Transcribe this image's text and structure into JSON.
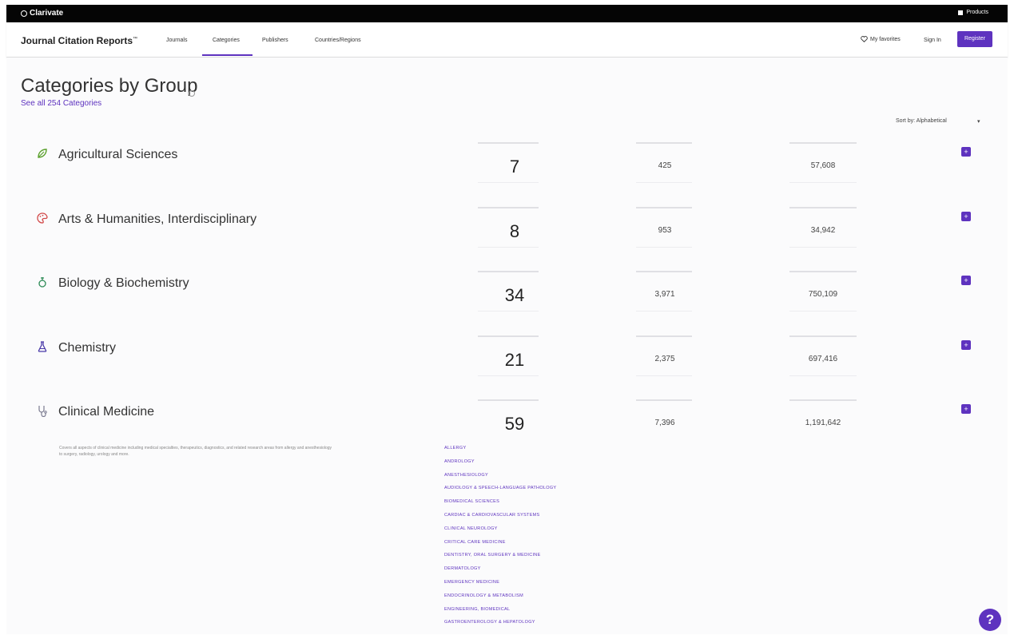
{
  "topbar": {
    "brand": "Clarivate",
    "products_label": "Products"
  },
  "nav": {
    "product_title": "Journal Citation Reports",
    "product_mark": "™",
    "links": [
      "Journals",
      "Categories",
      "Publishers",
      "Countries/Regions"
    ],
    "active_link": "Categories",
    "my_favorites": "My favorites",
    "sign_in": "Sign In",
    "register": "Register"
  },
  "header": {
    "title": "Categories by Group",
    "see_all": "See all 254 Categories",
    "sort_label": "Sort by: Alphabetical",
    "sort_caret": "▾"
  },
  "groups": [
    {
      "name": "Agricultural Sciences",
      "icon": "leaf-icon",
      "icon_color": "#5aa02c",
      "categories": "7",
      "journals": "425",
      "citable": "57,608"
    },
    {
      "name": "Arts & Humanities, Interdisciplinary",
      "icon": "palette-icon",
      "icon_color": "#d24a4a",
      "categories": "8",
      "journals": "953",
      "citable": "34,942"
    },
    {
      "name": "Biology & Biochemistry",
      "icon": "molecule-icon",
      "icon_color": "#2e8b57",
      "categories": "34",
      "journals": "3,971",
      "citable": "750,109"
    },
    {
      "name": "Chemistry",
      "icon": "flask-icon",
      "icon_color": "#4a3aa8",
      "categories": "21",
      "journals": "2,375",
      "citable": "697,416"
    },
    {
      "name": "Clinical Medicine",
      "icon": "stethoscope-icon",
      "icon_color": "#7a7a90",
      "categories": "59",
      "journals": "7,396",
      "citable": "1,191,642"
    }
  ],
  "expanded_description": "Covers all aspects of clinical medicine including medical specialties, therapeutics, diagnostics, and related research areas from allergy and anesthesiology to surgery, radiology, urology and more.",
  "subcategories": [
    "ALLERGY",
    "ANDROLOGY",
    "ANESTHESIOLOGY",
    "AUDIOLOGY & SPEECH-LANGUAGE PATHOLOGY",
    "BIOMEDICAL SCIENCES",
    "CARDIAC & CARDIOVASCULAR SYSTEMS",
    "CLINICAL NEUROLOGY",
    "CRITICAL CARE MEDICINE",
    "DENTISTRY, ORAL SURGERY & MEDICINE",
    "DERMATOLOGY",
    "EMERGENCY MEDICINE",
    "ENDOCRINOLOGY & METABOLISM",
    "ENGINEERING, BIOMEDICAL",
    "GASTROENTEROLOGY & HEPATOLOGY"
  ],
  "help_label": "?",
  "expand_label": "+",
  "colors": {
    "accent": "#5e33bf",
    "topbar": "#050505"
  }
}
